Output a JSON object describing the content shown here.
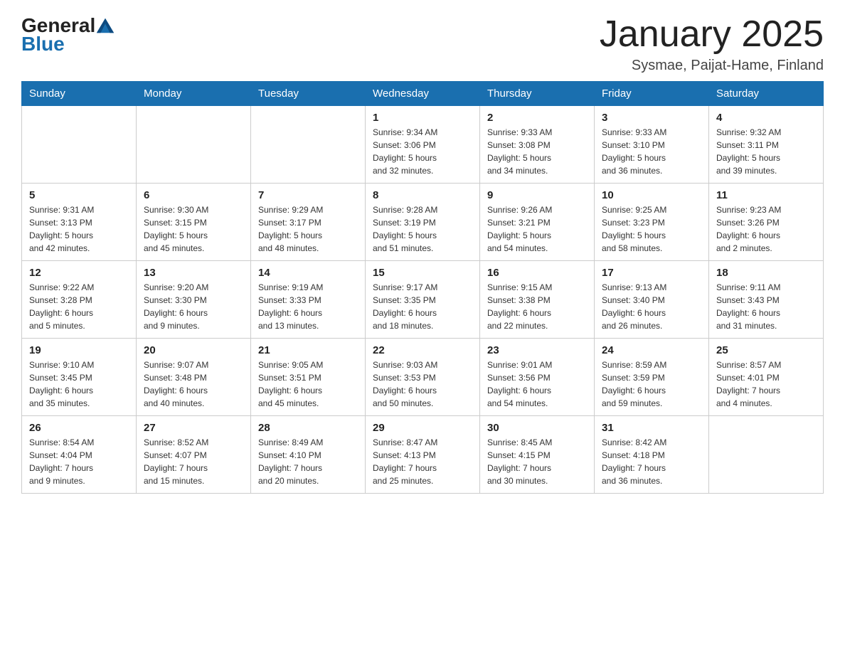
{
  "header": {
    "logo_general": "General",
    "logo_blue": "Blue",
    "month_title": "January 2025",
    "subtitle": "Sysmae, Paijat-Hame, Finland"
  },
  "weekdays": [
    "Sunday",
    "Monday",
    "Tuesday",
    "Wednesday",
    "Thursday",
    "Friday",
    "Saturday"
  ],
  "weeks": [
    [
      {
        "day": "",
        "info": ""
      },
      {
        "day": "",
        "info": ""
      },
      {
        "day": "",
        "info": ""
      },
      {
        "day": "1",
        "info": "Sunrise: 9:34 AM\nSunset: 3:06 PM\nDaylight: 5 hours\nand 32 minutes."
      },
      {
        "day": "2",
        "info": "Sunrise: 9:33 AM\nSunset: 3:08 PM\nDaylight: 5 hours\nand 34 minutes."
      },
      {
        "day": "3",
        "info": "Sunrise: 9:33 AM\nSunset: 3:10 PM\nDaylight: 5 hours\nand 36 minutes."
      },
      {
        "day": "4",
        "info": "Sunrise: 9:32 AM\nSunset: 3:11 PM\nDaylight: 5 hours\nand 39 minutes."
      }
    ],
    [
      {
        "day": "5",
        "info": "Sunrise: 9:31 AM\nSunset: 3:13 PM\nDaylight: 5 hours\nand 42 minutes."
      },
      {
        "day": "6",
        "info": "Sunrise: 9:30 AM\nSunset: 3:15 PM\nDaylight: 5 hours\nand 45 minutes."
      },
      {
        "day": "7",
        "info": "Sunrise: 9:29 AM\nSunset: 3:17 PM\nDaylight: 5 hours\nand 48 minutes."
      },
      {
        "day": "8",
        "info": "Sunrise: 9:28 AM\nSunset: 3:19 PM\nDaylight: 5 hours\nand 51 minutes."
      },
      {
        "day": "9",
        "info": "Sunrise: 9:26 AM\nSunset: 3:21 PM\nDaylight: 5 hours\nand 54 minutes."
      },
      {
        "day": "10",
        "info": "Sunrise: 9:25 AM\nSunset: 3:23 PM\nDaylight: 5 hours\nand 58 minutes."
      },
      {
        "day": "11",
        "info": "Sunrise: 9:23 AM\nSunset: 3:26 PM\nDaylight: 6 hours\nand 2 minutes."
      }
    ],
    [
      {
        "day": "12",
        "info": "Sunrise: 9:22 AM\nSunset: 3:28 PM\nDaylight: 6 hours\nand 5 minutes."
      },
      {
        "day": "13",
        "info": "Sunrise: 9:20 AM\nSunset: 3:30 PM\nDaylight: 6 hours\nand 9 minutes."
      },
      {
        "day": "14",
        "info": "Sunrise: 9:19 AM\nSunset: 3:33 PM\nDaylight: 6 hours\nand 13 minutes."
      },
      {
        "day": "15",
        "info": "Sunrise: 9:17 AM\nSunset: 3:35 PM\nDaylight: 6 hours\nand 18 minutes."
      },
      {
        "day": "16",
        "info": "Sunrise: 9:15 AM\nSunset: 3:38 PM\nDaylight: 6 hours\nand 22 minutes."
      },
      {
        "day": "17",
        "info": "Sunrise: 9:13 AM\nSunset: 3:40 PM\nDaylight: 6 hours\nand 26 minutes."
      },
      {
        "day": "18",
        "info": "Sunrise: 9:11 AM\nSunset: 3:43 PM\nDaylight: 6 hours\nand 31 minutes."
      }
    ],
    [
      {
        "day": "19",
        "info": "Sunrise: 9:10 AM\nSunset: 3:45 PM\nDaylight: 6 hours\nand 35 minutes."
      },
      {
        "day": "20",
        "info": "Sunrise: 9:07 AM\nSunset: 3:48 PM\nDaylight: 6 hours\nand 40 minutes."
      },
      {
        "day": "21",
        "info": "Sunrise: 9:05 AM\nSunset: 3:51 PM\nDaylight: 6 hours\nand 45 minutes."
      },
      {
        "day": "22",
        "info": "Sunrise: 9:03 AM\nSunset: 3:53 PM\nDaylight: 6 hours\nand 50 minutes."
      },
      {
        "day": "23",
        "info": "Sunrise: 9:01 AM\nSunset: 3:56 PM\nDaylight: 6 hours\nand 54 minutes."
      },
      {
        "day": "24",
        "info": "Sunrise: 8:59 AM\nSunset: 3:59 PM\nDaylight: 6 hours\nand 59 minutes."
      },
      {
        "day": "25",
        "info": "Sunrise: 8:57 AM\nSunset: 4:01 PM\nDaylight: 7 hours\nand 4 minutes."
      }
    ],
    [
      {
        "day": "26",
        "info": "Sunrise: 8:54 AM\nSunset: 4:04 PM\nDaylight: 7 hours\nand 9 minutes."
      },
      {
        "day": "27",
        "info": "Sunrise: 8:52 AM\nSunset: 4:07 PM\nDaylight: 7 hours\nand 15 minutes."
      },
      {
        "day": "28",
        "info": "Sunrise: 8:49 AM\nSunset: 4:10 PM\nDaylight: 7 hours\nand 20 minutes."
      },
      {
        "day": "29",
        "info": "Sunrise: 8:47 AM\nSunset: 4:13 PM\nDaylight: 7 hours\nand 25 minutes."
      },
      {
        "day": "30",
        "info": "Sunrise: 8:45 AM\nSunset: 4:15 PM\nDaylight: 7 hours\nand 30 minutes."
      },
      {
        "day": "31",
        "info": "Sunrise: 8:42 AM\nSunset: 4:18 PM\nDaylight: 7 hours\nand 36 minutes."
      },
      {
        "day": "",
        "info": ""
      }
    ]
  ]
}
